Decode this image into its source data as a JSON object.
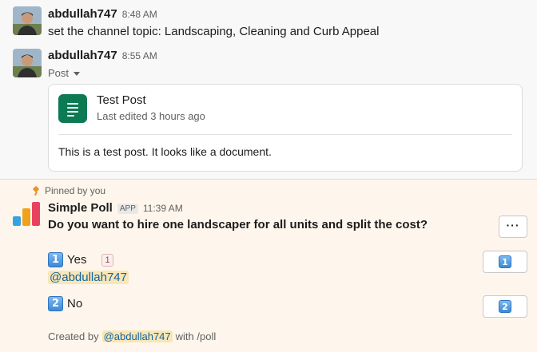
{
  "messages": [
    {
      "author": "abdullah747",
      "time": "8:48 AM",
      "text": "set the channel topic: Landscaping, Cleaning and Curb Appeal"
    },
    {
      "author": "abdullah747",
      "time": "8:55 AM",
      "post_label": "Post",
      "post": {
        "title": "Test Post",
        "subtitle": "Last edited 3 hours ago",
        "body": "This is a test post. It looks like a document.",
        "icon": "document-icon"
      }
    }
  ],
  "poll_message": {
    "pinned_label": "Pinned by you",
    "author": "Simple Poll",
    "badge": "APP",
    "time": "11:39 AM",
    "question": "Do you want to hire one landscaper for all units and split the cost?",
    "more_label": "···",
    "options": [
      {
        "keycap": "1",
        "label": "Yes",
        "count": "1",
        "voter": "@abdullah747"
      },
      {
        "keycap": "2",
        "label": "No"
      }
    ],
    "footer": {
      "prefix": "Created by",
      "mention": "@abdullah747",
      "suffix": "with /poll"
    }
  },
  "colors": {
    "doc_green": "#0c7a53",
    "pin_orange": "#e8912d",
    "pinned_bg": "#fef6ec",
    "mention_bg": "#f8e6b5",
    "mention_text": "#1264a3"
  }
}
